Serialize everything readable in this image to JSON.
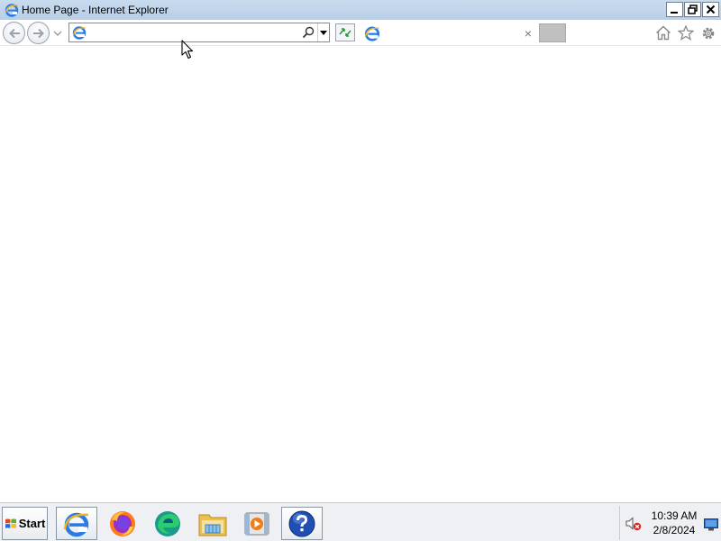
{
  "window": {
    "title": "Home Page - Internet Explorer",
    "controls": [
      "minimize",
      "restore",
      "close"
    ]
  },
  "toolbar": {
    "address_value": "",
    "address_icon": "ie-icon",
    "search_icon": "search-icon",
    "tab_label": "",
    "tab_icon": "ie-icon",
    "tab_close_glyph": "×"
  },
  "taskbar": {
    "start_label": "Start",
    "pinned": [
      "internet-explorer",
      "firefox",
      "edge",
      "file-explorer",
      "media-player",
      "help"
    ],
    "clock_time": "10:39 AM",
    "clock_date": "2/8/2024"
  },
  "colors": {
    "titlebar": "#c9dbee",
    "taskbar": "#eef0f3",
    "accent_blue": "#1e6fd9"
  }
}
